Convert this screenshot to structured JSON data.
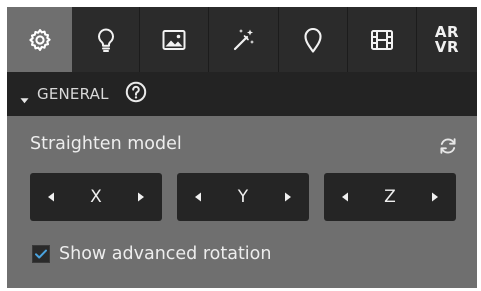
{
  "tabs": [
    {
      "name": "settings",
      "icon": "gear-icon",
      "active": true
    },
    {
      "name": "lighting",
      "icon": "lightbulb-icon",
      "active": false
    },
    {
      "name": "background",
      "icon": "image-icon",
      "active": false
    },
    {
      "name": "post-processing",
      "icon": "magic-wand-icon",
      "active": false
    },
    {
      "name": "annotations",
      "icon": "location-pin-icon",
      "active": false
    },
    {
      "name": "animations",
      "icon": "film-icon",
      "active": false
    },
    {
      "name": "ar-vr",
      "label_line1": "AR",
      "label_line2": "VR",
      "active": false
    }
  ],
  "section": {
    "title": "GENERAL",
    "collapse_icon": "caret-down-icon",
    "help_icon": "question-circle-icon"
  },
  "straighten": {
    "label": "Straighten model",
    "reset_icon": "refresh-icon",
    "axes": [
      {
        "label": "X"
      },
      {
        "label": "Y"
      },
      {
        "label": "Z"
      }
    ]
  },
  "advanced_rotation": {
    "label": "Show advanced rotation",
    "checked": true
  },
  "colors": {
    "panel_bg": "#6f6f6f",
    "tabbar_bg": "#2b2b2b",
    "header_bg": "#232323",
    "button_bg": "#252525",
    "checkbox_accent": "#4aa3df"
  }
}
